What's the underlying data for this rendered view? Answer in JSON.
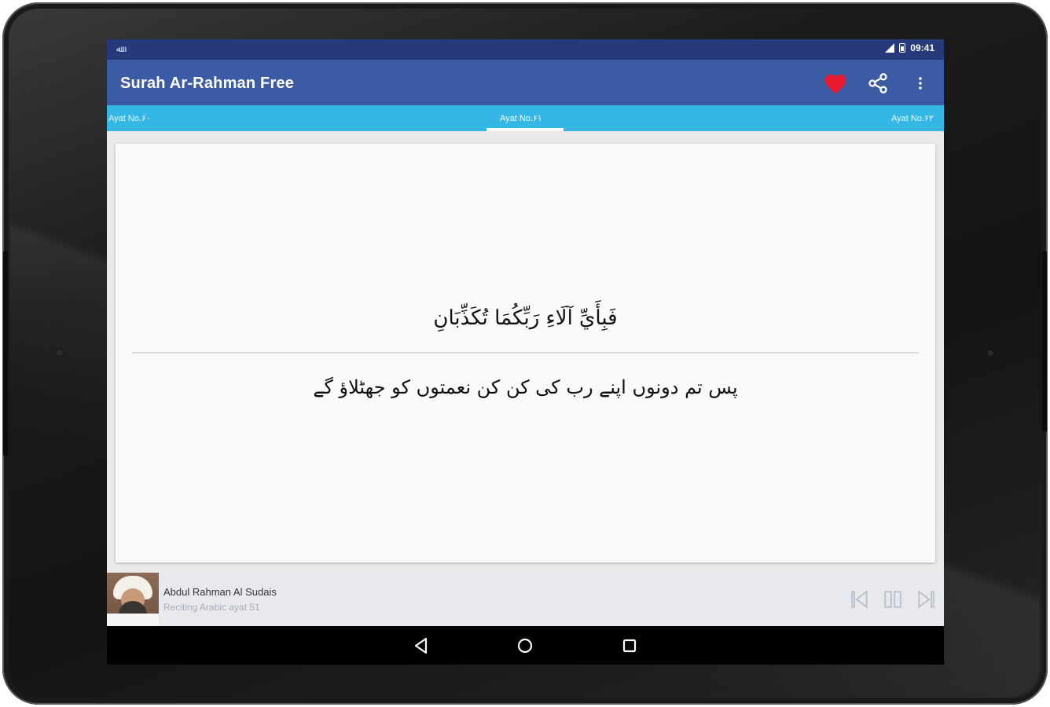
{
  "status_bar": {
    "time": "09:41",
    "left_glyph": "ﷲ"
  },
  "app_bar": {
    "title": "Surah Ar-Rahman Free",
    "icons": [
      "heart-icon",
      "share-icon",
      "more-vert-icon"
    ],
    "heart_color": "#e8192c"
  },
  "tabs": {
    "items": [
      {
        "label": "Ayat No.۶۰"
      },
      {
        "label": "Ayat No.۶۱"
      },
      {
        "label": "Ayat No.۶۲"
      }
    ],
    "active_index": 1,
    "color": "#35b7e6"
  },
  "ayah": {
    "arabic": "فَبِأَيِّ آلَاءِ رَبِّكُمَا تُكَذِّبَانِ",
    "urdu": "پس تم دونوں اپنے رب کی کن کن نعمتوں کو جھٹلاؤ گے"
  },
  "player": {
    "reciter": "Abdul Rahman Al Sudais",
    "status": "Reciting Arabic ayat 51",
    "controls": [
      "skip-previous-icon",
      "pause-icon",
      "skip-next-icon"
    ]
  },
  "nav_bar": {
    "icons": [
      "back-icon",
      "home-icon",
      "recents-icon"
    ]
  },
  "colors": {
    "status_bar": "#26397a",
    "app_bar": "#3b5ba5",
    "card": "#fafafa",
    "player": "#e7e9ee"
  }
}
